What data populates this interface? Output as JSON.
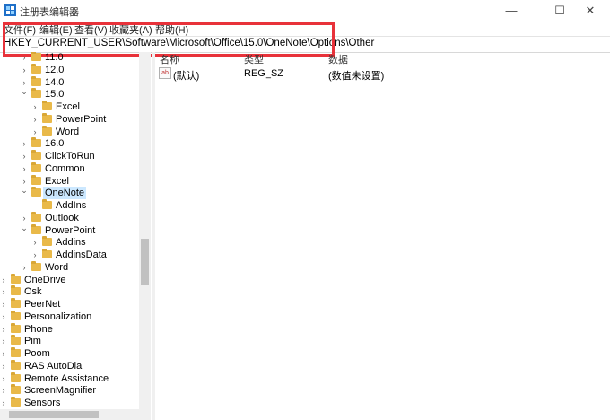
{
  "window": {
    "title": "注册表编辑器",
    "minimize": "—",
    "maximize": "☐",
    "close": "✕"
  },
  "menu": [
    "文件(F)",
    "编辑(E)",
    "查看(V)",
    "收藏夹(A)",
    "帮助(H)"
  ],
  "address": "HKEY_CURRENT_USER\\Software\\Microsoft\\Office\\15.0\\OneNote\\Options\\Other",
  "columns": {
    "name": "名称",
    "type": "类型",
    "data": "数据"
  },
  "values": [
    {
      "icon": "ab",
      "name": "(默认)",
      "type": "REG_SZ",
      "data": "(数值未设置)"
    }
  ],
  "tree": [
    {
      "label": "11.0",
      "level": 2,
      "expanded": false
    },
    {
      "label": "12.0",
      "level": 2,
      "expanded": false
    },
    {
      "label": "14.0",
      "level": 2,
      "expanded": false
    },
    {
      "label": "15.0",
      "level": 2,
      "expanded": true
    },
    {
      "label": "Excel",
      "level": 3,
      "expanded": false
    },
    {
      "label": "PowerPoint",
      "level": 3,
      "expanded": false
    },
    {
      "label": "Word",
      "level": 3,
      "expanded": false
    },
    {
      "label": "16.0",
      "level": 2,
      "expanded": false
    },
    {
      "label": "ClickToRun",
      "level": 2,
      "expanded": false
    },
    {
      "label": "Common",
      "level": 2,
      "expanded": false
    },
    {
      "label": "Excel",
      "level": 2,
      "expanded": false
    },
    {
      "label": "OneNote",
      "level": 2,
      "expanded": true,
      "selected": true
    },
    {
      "label": "AddIns",
      "level": 3,
      "leaf": true
    },
    {
      "label": "Outlook",
      "level": 2,
      "expanded": false
    },
    {
      "label": "PowerPoint",
      "level": 2,
      "expanded": true
    },
    {
      "label": "Addins",
      "level": 3,
      "expanded": false
    },
    {
      "label": "AddinsData",
      "level": 3,
      "expanded": false
    },
    {
      "label": "Word",
      "level": 2,
      "expanded": false
    },
    {
      "label": "OneDrive",
      "level": 1,
      "expanded": false
    },
    {
      "label": "Osk",
      "level": 1,
      "expanded": false
    },
    {
      "label": "PeerNet",
      "level": 1,
      "expanded": false
    },
    {
      "label": "Personalization",
      "level": 1,
      "expanded": false
    },
    {
      "label": "Phone",
      "level": 1,
      "expanded": false
    },
    {
      "label": "Pim",
      "level": 1,
      "expanded": false
    },
    {
      "label": "Poom",
      "level": 1,
      "expanded": false
    },
    {
      "label": "RAS AutoDial",
      "level": 1,
      "expanded": false
    },
    {
      "label": "Remote Assistance",
      "level": 1,
      "expanded": false
    },
    {
      "label": "ScreenMagnifier",
      "level": 1,
      "expanded": false
    },
    {
      "label": "Sensors",
      "level": 1,
      "expanded": false
    }
  ]
}
